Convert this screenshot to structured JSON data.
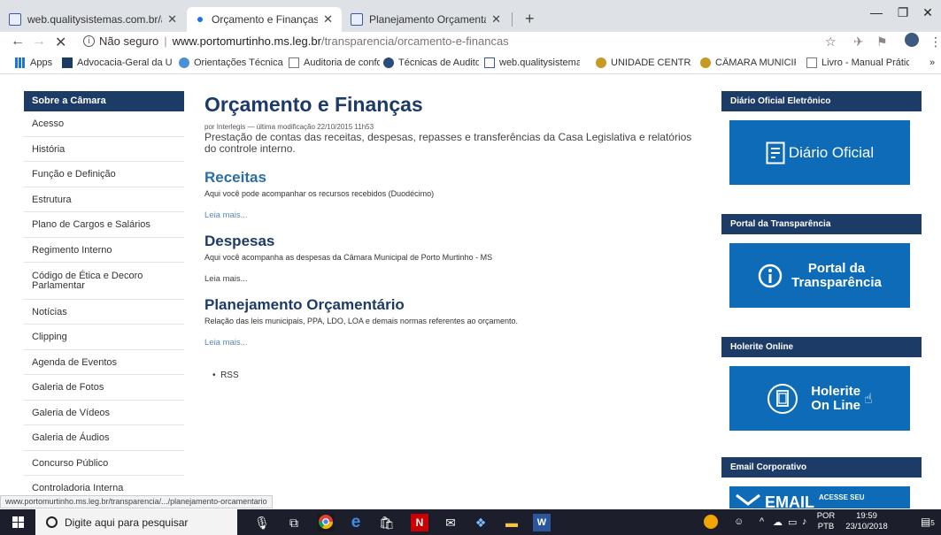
{
  "browser": {
    "tabs": [
      {
        "title": "web.qualitysistemas.com.br/adm",
        "active": false
      },
      {
        "title": "Orçamento e Finanças — Câmara",
        "active": true
      },
      {
        "title": "Planejamento Orçamentário",
        "active": false
      }
    ],
    "new_tab": "+",
    "address": {
      "security": "Não seguro",
      "domain": "www.portomurtinho.ms.leg.br",
      "path": "/transparencia/orcamento-e-financas"
    },
    "bookmarks": [
      {
        "label": "Apps",
        "icon": "apps-grid-icon"
      },
      {
        "label": "Advocacia-Geral da U",
        "icon": "agu-icon"
      },
      {
        "label": "Orientações Técnicas",
        "icon": "globe-icon"
      },
      {
        "label": "Auditoria de conform",
        "icon": "page-icon"
      },
      {
        "label": "Técnicas de Auditoria",
        "icon": "audit-icon"
      },
      {
        "label": "web.qualitysistemas.",
        "icon": "doc-icon"
      },
      {
        "label": "UNIDADE CENTRAL C",
        "icon": "seal-icon"
      },
      {
        "label": "CÂMARA MUNICIPAL",
        "icon": "seal-icon"
      },
      {
        "label": "Livro - Manual Prátic",
        "icon": "page-icon"
      }
    ],
    "overflow": "»"
  },
  "sidebar": {
    "heading": "Sobre a Câmara",
    "items": [
      "Acesso",
      "História",
      "Função e Definição",
      "Estrutura",
      "Plano de Cargos e Salários",
      "Regimento Interno",
      "Código de Ética e Decoro Parlamentar",
      "Notícias",
      "Clipping",
      "Agenda de Eventos",
      "Galeria de Fotos",
      "Galeria de Vídeos",
      "Galeria de Áudios",
      "Concurso Público",
      "Controladoria Interna"
    ]
  },
  "main": {
    "title": "Orçamento e Finanças",
    "byline": "por Interlegis — última modificação 22/10/2015 11h53",
    "description": "Prestação de contas das receitas, despesas, repasses e transferências da Casa Legislativa e relatórios do controle interno.",
    "sections": [
      {
        "title": "Receitas",
        "text": "Aqui você pode acompanhar os recursos recebidos (Duodécimo)",
        "more": "Leia mais..."
      },
      {
        "title": "Despesas",
        "text": "Aqui você acompanha as despesas da Câmara Municipal de Porto Murtinho - MS",
        "more": "Leia mais..."
      },
      {
        "title": "Planejamento Orçamentário",
        "text": "Relação das leis municipais, PPA, LDO, LOA e demais normas referentes ao orçamento.",
        "more": "Leia mais..."
      }
    ],
    "rss": "RSS"
  },
  "right": {
    "blocks": [
      {
        "heading": "Diário Oficial Eletrônico",
        "banner": "Diário Oficial"
      },
      {
        "heading": "Portal da Transparência",
        "banner_line1": "Portal da",
        "banner_line2": "Transparência"
      },
      {
        "heading": "Holerite Online",
        "banner_line1": "Holerite",
        "banner_line2": "On Line"
      },
      {
        "heading": "Email Corporativo",
        "banner_line1": "EMAIL",
        "banner_line2": "ACESSE SEU"
      }
    ]
  },
  "status_link": "www.portomurtinho.ms.leg.br/transparencia/.../planejamento-orcamentario",
  "taskbar": {
    "search_placeholder": "Digite aqui para pesquisar",
    "lang1": "POR",
    "lang2": "PTB",
    "time": "19:59",
    "date": "23/10/2018",
    "notif_count": "5"
  }
}
